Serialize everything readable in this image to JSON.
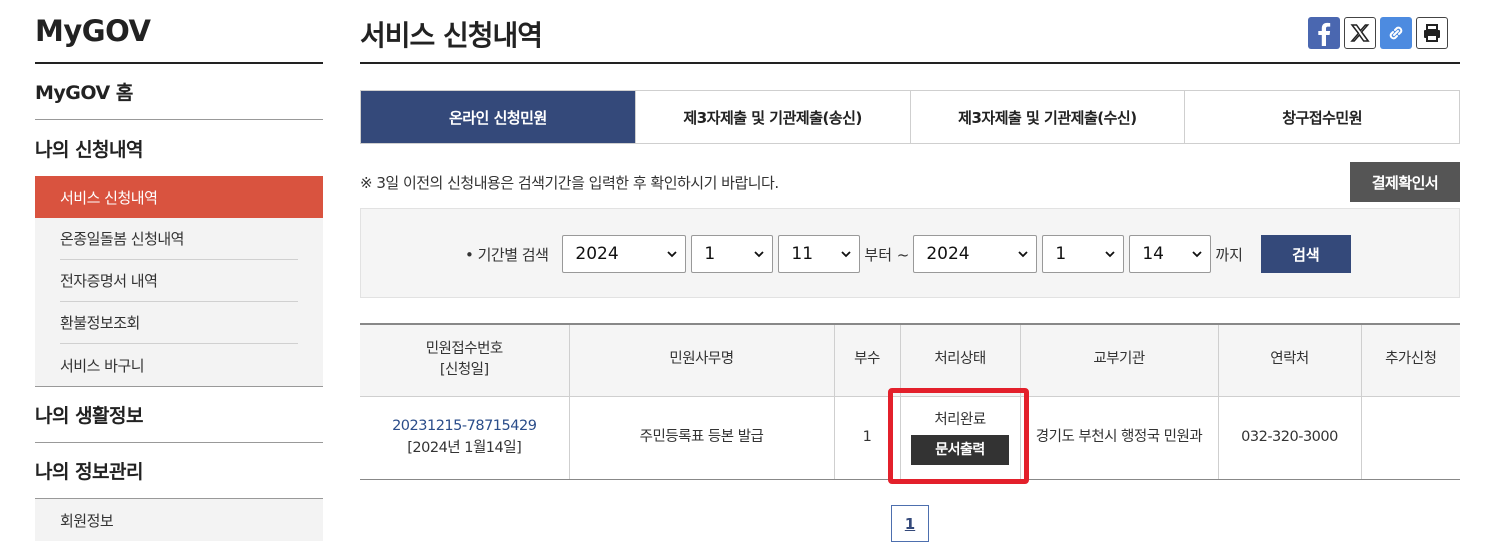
{
  "sidebar": {
    "brand": "MyGOV",
    "home": "MyGOV 홈",
    "sections": [
      {
        "title": "나의 신청내역",
        "items": [
          "서비스 신청내역",
          "온종일돌봄 신청내역",
          "전자증명서 내역",
          "환불정보조회",
          "서비스 바구니"
        ]
      },
      {
        "title": "나의 생활정보"
      },
      {
        "title": "나의 정보관리",
        "items": [
          "회원정보"
        ]
      }
    ]
  },
  "page": {
    "title": "서비스 신청내역",
    "share": {
      "facebook": "facebook-icon",
      "x": "x-icon",
      "link": "link-icon",
      "print": "print-icon"
    }
  },
  "tabs": [
    "온라인 신청민원",
    "제3자제출 및 기관제출(송신)",
    "제3자제출 및 기관제출(수신)",
    "창구접수민원"
  ],
  "notice": "※ 3일 이전의 신청내용은 검색기간을 입력한 후 확인하시기 바랍니다.",
  "confirm_button": "결제확인서",
  "search": {
    "label": "• 기간별 검색",
    "from": {
      "year": "2024",
      "month": "1",
      "day": "11"
    },
    "from_suffix": "부터 ~",
    "to": {
      "year": "2024",
      "month": "1",
      "day": "14"
    },
    "to_suffix": "까지",
    "button": "검색"
  },
  "table": {
    "headers": {
      "reqno_line1": "민원접수번호",
      "reqno_line2": "[신청일]",
      "service": "민원사무명",
      "copies": "부수",
      "status": "처리상태",
      "agency": "교부기관",
      "contact": "연락처",
      "extra": "추가신청"
    },
    "rows": [
      {
        "reqno": "20231215-78715429",
        "date": "[2024년 1월14일]",
        "service": "주민등록표 등본 발급",
        "copies": "1",
        "status": "처리완료",
        "print_label": "문서출력",
        "agency": "경기도 부천시 행정국 민원과",
        "contact": "032-320-3000",
        "extra": ""
      }
    ]
  },
  "pagination": {
    "current": "1"
  },
  "colors": {
    "accent": "#34497a",
    "active_menu": "#d9533f",
    "highlight": "#e3202b"
  }
}
